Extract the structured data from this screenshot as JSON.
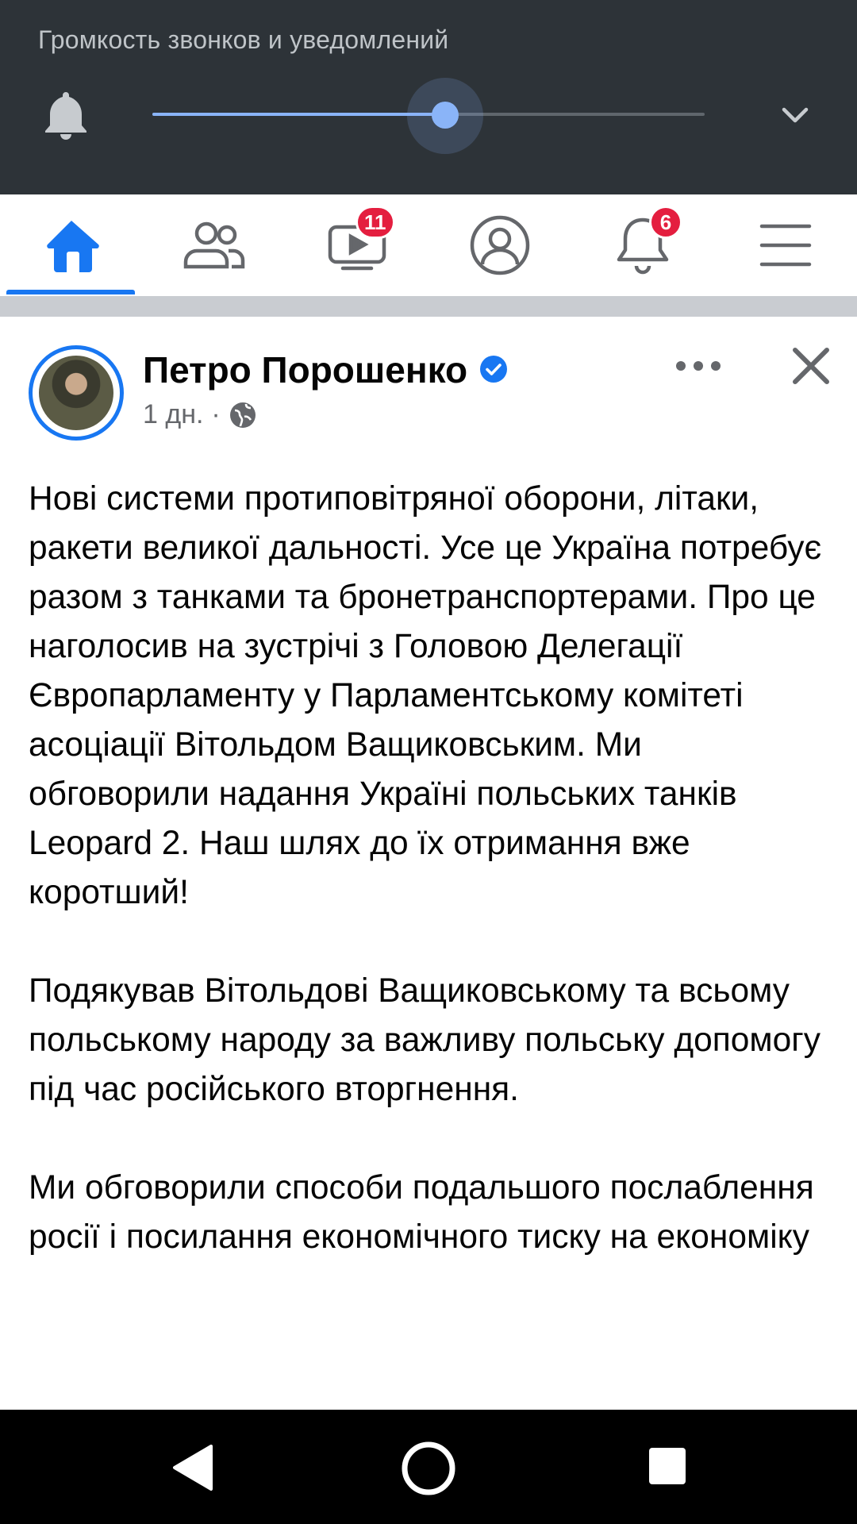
{
  "volume_panel": {
    "title": "Громкость звонков и уведомлений",
    "level": 0.53,
    "icons": {
      "bell": "bell-icon",
      "expand": "chevron-down-icon"
    },
    "accent": "#8ab4f8"
  },
  "fb_nav": {
    "active_color": "#1877f2",
    "tabs": [
      {
        "icon": "home-icon",
        "active": true
      },
      {
        "icon": "friends-icon"
      },
      {
        "icon": "watch-icon",
        "badge": "11"
      },
      {
        "icon": "profile-icon"
      },
      {
        "icon": "notifications-icon",
        "badge": "6"
      },
      {
        "icon": "menu-icon"
      }
    ]
  },
  "post": {
    "author": "Петро Порошенко",
    "verified_icon": "verified-badge-icon",
    "time": "1 дн.",
    "separator": "·",
    "audience_icon": "globe-icon",
    "paragraphs": [
      "Нові системи протиповітряної оборони, літаки, ракети великої дальності. Усе це Україна потребує разом з танками та бронетранспортерами. Про це наголосив на зустрічі з Головою Делегації Європарламенту у Парламентському комітеті асоціації Вітольдом Ващиковським. Ми обговорили надання Україні польських танків Leopard 2. Наш шлях до їх отримання вже коротший!",
      "Подякував Вітольдові Ващиковському та всьому польському народу за важливу польську допомогу під час російського вторгнення.",
      "Ми обговорили способи подальшого послаблення росії і посилання економічного тиску на економіку"
    ]
  },
  "android_nav": {
    "icons": [
      "back-icon",
      "home-circle-icon",
      "recents-icon"
    ]
  }
}
